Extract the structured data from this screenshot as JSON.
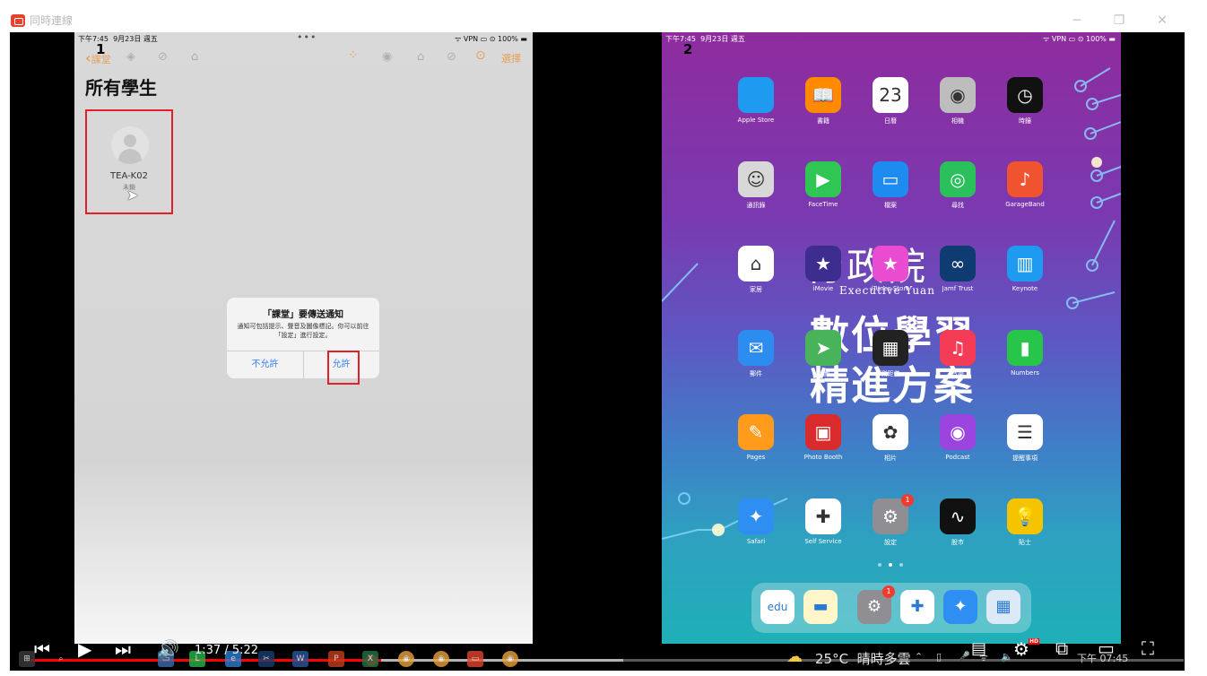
{
  "window": {
    "title": "同時連線",
    "controls": [
      "─",
      "❐",
      "✕"
    ]
  },
  "left_screen": {
    "label": "1",
    "status": {
      "time": "下午7:45",
      "date": "9月23日 週五",
      "dots": "•••",
      "right": "ᯤ VPN ▭ ⊙ 100% ▬"
    },
    "nav": {
      "back_label": "課堂",
      "select_label": "選擇"
    },
    "heading": "所有學生",
    "student": {
      "name": "TEA-K02",
      "status": "未鎖"
    },
    "dialog": {
      "title": "「課堂」要傳送通知",
      "body": "通知可包括提示、聲音及圖像標記。你可以前往「設定」進行設定。",
      "deny": "不允許",
      "allow": "允許"
    }
  },
  "right_screen": {
    "label": "2",
    "status": {
      "time": "下午7:45",
      "date": "9月23日 週五",
      "right": "ᯤ VPN ▭ ⊙ 100% ▬"
    },
    "wallpaper": {
      "logo": "行政院",
      "logo_en": "Executive Yuan",
      "slogan_line1": "數位學習",
      "slogan_line2": "精進方案"
    },
    "apps": [
      {
        "label": "Apple Store",
        "glyph": "",
        "color": "#1e9bf0",
        "badge": ""
      },
      {
        "label": "書籍",
        "glyph": "📖",
        "color": "#ff8a00",
        "badge": ""
      },
      {
        "label": "日曆",
        "glyph": "23",
        "color": "#ffffff",
        "badge": ""
      },
      {
        "label": "相機",
        "glyph": "◉",
        "color": "#bdbdbd",
        "badge": ""
      },
      {
        "label": "時鐘",
        "glyph": "◷",
        "color": "#111111",
        "badge": ""
      },
      {
        "label": "通訊錄",
        "glyph": "☺",
        "color": "#d8d8d8",
        "badge": ""
      },
      {
        "label": "FaceTime",
        "glyph": "▶",
        "color": "#2fc653",
        "badge": ""
      },
      {
        "label": "檔案",
        "glyph": "▭",
        "color": "#1e8bf0",
        "badge": ""
      },
      {
        "label": "尋找",
        "glyph": "◎",
        "color": "#2bc05c",
        "badge": ""
      },
      {
        "label": "GarageBand",
        "glyph": "♪",
        "color": "#f0532f",
        "badge": ""
      },
      {
        "label": "家居",
        "glyph": "⌂",
        "color": "#ffffff",
        "badge": ""
      },
      {
        "label": "iMovie",
        "glyph": "★",
        "color": "#3d2d8e",
        "badge": ""
      },
      {
        "label": "iTunes Store",
        "glyph": "★",
        "color": "#e94bd1",
        "badge": ""
      },
      {
        "label": "Jamf Trust",
        "glyph": "∞",
        "color": "#0f3b73",
        "badge": ""
      },
      {
        "label": "Keynote",
        "glyph": "▥",
        "color": "#1e9bf0",
        "badge": ""
      },
      {
        "label": "郵件",
        "glyph": "✉",
        "color": "#2d8cf0",
        "badge": ""
      },
      {
        "label": "地圖",
        "glyph": "➤",
        "color": "#49b35b",
        "badge": ""
      },
      {
        "label": "測距儀",
        "glyph": "▦",
        "color": "#222222",
        "badge": ""
      },
      {
        "label": "音樂",
        "glyph": "♫",
        "color": "#f43c56",
        "badge": ""
      },
      {
        "label": "Numbers",
        "glyph": "▮",
        "color": "#27c64b",
        "badge": ""
      },
      {
        "label": "Pages",
        "glyph": "✎",
        "color": "#ff9a1a",
        "badge": ""
      },
      {
        "label": "Photo Booth",
        "glyph": "▣",
        "color": "#d92b2b",
        "badge": ""
      },
      {
        "label": "相片",
        "glyph": "✿",
        "color": "#ffffff",
        "badge": ""
      },
      {
        "label": "Podcast",
        "glyph": "◉",
        "color": "#9b44e0",
        "badge": ""
      },
      {
        "label": "提醒事項",
        "glyph": "☰",
        "color": "#ffffff",
        "badge": ""
      },
      {
        "label": "Safari",
        "glyph": "✦",
        "color": "#2f8ef2",
        "badge": ""
      },
      {
        "label": "Self Service",
        "glyph": "✚",
        "color": "#ffffff",
        "badge": ""
      },
      {
        "label": "設定",
        "glyph": "⚙",
        "color": "#8e8e93",
        "badge": "1"
      },
      {
        "label": "股市",
        "glyph": "∿",
        "color": "#111111",
        "badge": ""
      },
      {
        "label": "貼士",
        "glyph": "💡",
        "color": "#f5c400",
        "badge": ""
      }
    ],
    "dock": [
      {
        "label": "edu 教育雲",
        "glyph": "edu",
        "color": "#ffffff",
        "badge": ""
      },
      {
        "label": "備忘錄",
        "glyph": "▬",
        "color": "#fff7c9",
        "badge": ""
      },
      {
        "label": "設定",
        "glyph": "⚙",
        "color": "#8e8e93",
        "badge": "1"
      },
      {
        "label": "Self Service",
        "glyph": "✚",
        "color": "#ffffff",
        "badge": ""
      },
      {
        "label": "Safari",
        "glyph": "✦",
        "color": "#2f8ef2",
        "badge": ""
      },
      {
        "label": "最近使用",
        "glyph": "▦",
        "color": "#dce9f6",
        "badge": ""
      }
    ]
  },
  "player": {
    "current_time": "1:37",
    "duration": "5:22",
    "time_display": "1:37 / 5:22",
    "played_fraction": 0.304,
    "buffered_fraction": 0.514,
    "hd_badge": "HD"
  },
  "taskbar": {
    "weather_temp": "25°C",
    "weather_text": "晴時多雲",
    "clock": "下午 07:45",
    "icons": [
      "windows-icon",
      "search-icon",
      "task-view-icon",
      "file-explorer-icon",
      "line-icon",
      "edge-icon",
      "snipping-icon",
      "word-icon",
      "powerpoint-icon",
      "excel-icon",
      "chrome-icon",
      "chrome-profile-icon",
      "screen-share-icon",
      "chrome-alt-icon"
    ]
  }
}
